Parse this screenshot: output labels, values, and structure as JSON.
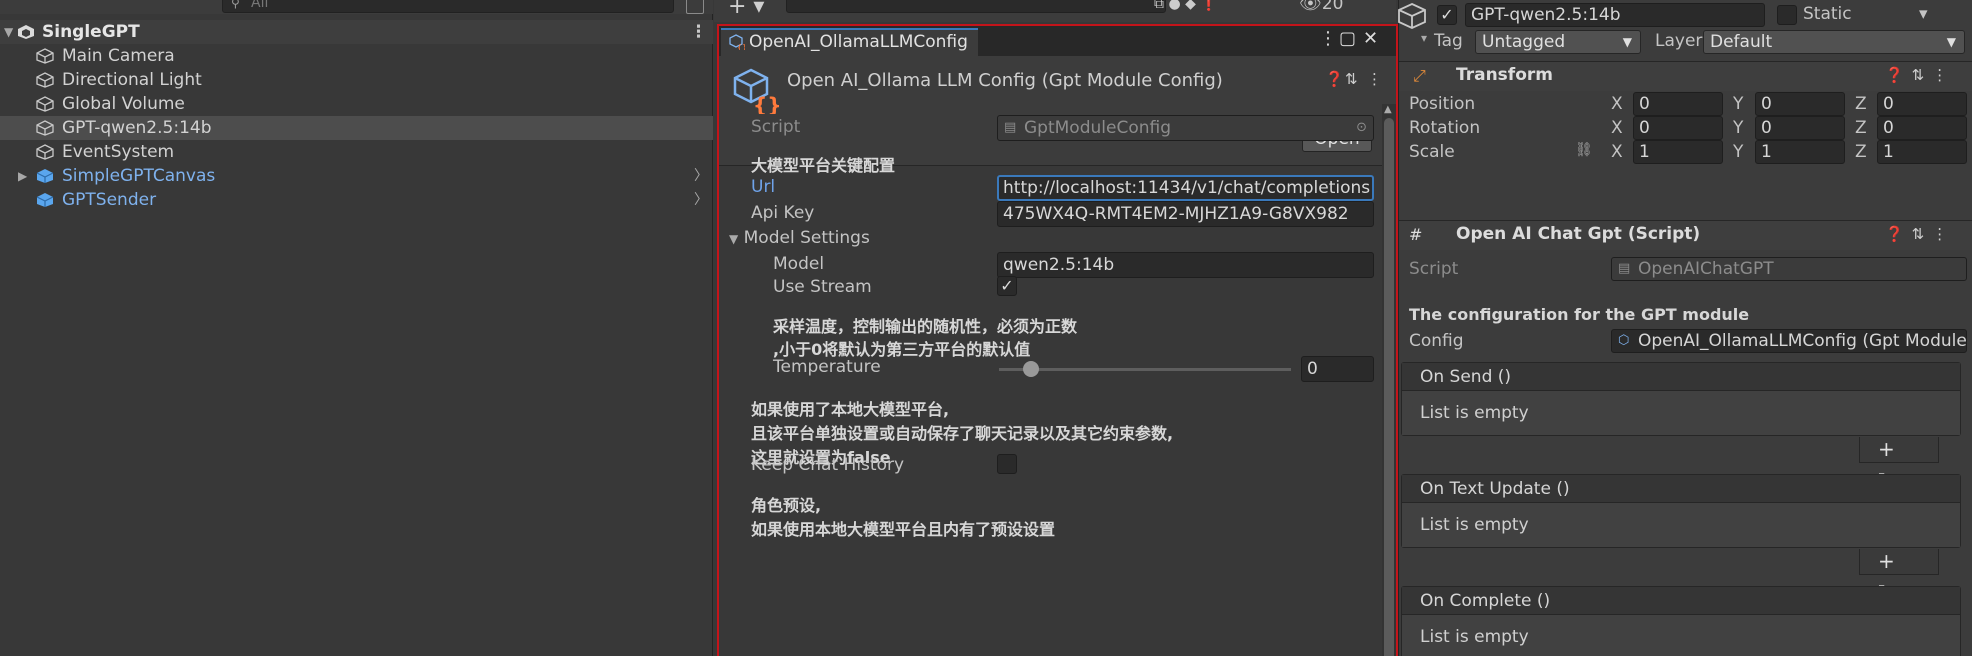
{
  "hierarchy": {
    "search_placeholder": "All",
    "scene": "SingleGPT",
    "items": [
      {
        "label": "Main Camera"
      },
      {
        "label": "Directional Light"
      },
      {
        "label": "Global Volume"
      },
      {
        "label": "GPT-qwen2.5:14b"
      },
      {
        "label": "EventSystem"
      },
      {
        "label": "SimpleGPTCanvas"
      },
      {
        "label": "GPTSender"
      }
    ]
  },
  "scene_toolbar": {
    "visibility_count": "20"
  },
  "floating": {
    "tab_title": "OpenAI_OllamaLLMConfig",
    "header_title": "Open AI_Ollama LLM Config (Gpt Module Config)",
    "open_label": "Open",
    "script_label": "Script",
    "script_value": "GptModuleConfig",
    "section_heading": "大模型平台关键配置",
    "url_label": "Url",
    "url_value": "http://localhost:11434/v1/chat/completions",
    "apikey_label": "Api Key",
    "apikey_value": "475WX4Q-RMT4EM2-MJHZ1A9-G8VX982",
    "model_settings_label": "Model Settings",
    "model_label": "Model",
    "model_value": "qwen2.5:14b",
    "use_stream_label": "Use Stream",
    "use_stream_checked": true,
    "temp_help_line1": "采样温度，控制输出的随机性，必须为正数",
    "temp_help_line2": ",小于0将默认为第三方平台的默认值",
    "temperature_label": "Temperature",
    "temperature_value": "0",
    "history_help_line1": "如果使用了本地大模型平台,",
    "history_help_line2": "且该平台单独设置或自动保存了聊天记录以及其它约束参数,",
    "history_help_line3": "这里就设置为false",
    "keep_history_label": "Keep Chat History",
    "keep_history_checked": false,
    "role_help_line1": "角色预设,",
    "role_help_line2": "如果使用本地大模型平台且内有了预设设置"
  },
  "inspector": {
    "object_name": "GPT-qwen2.5:14b",
    "static_label": "Static",
    "tag_label": "Tag",
    "tag_value": "Untagged",
    "layer_label": "Layer",
    "layer_value": "Default",
    "transform": {
      "title": "Transform",
      "position_label": "Position",
      "rotation_label": "Rotation",
      "scale_label": "Scale",
      "position": [
        "0",
        "0",
        "0"
      ],
      "rotation": [
        "0",
        "0",
        "0"
      ],
      "scale": [
        "1",
        "1",
        "1"
      ],
      "axis_x": "X",
      "axis_y": "Y",
      "axis_z": "Z"
    },
    "script_comp": {
      "title": "Open AI Chat Gpt (Script)",
      "script_label": "Script",
      "script_value": "OpenAIChatGPT",
      "config_heading": "The configuration for the GPT module",
      "config_label": "Config",
      "config_value": "OpenAI_OllamaLLMConfig (Gpt Module Config)"
    },
    "events": [
      {
        "name": "On Send ()",
        "body": "List is empty"
      },
      {
        "name": "On Text Update ()",
        "body": "List is empty"
      },
      {
        "name": "On Complete ()",
        "body": "List is empty"
      }
    ],
    "plus_minus": "+ -"
  }
}
